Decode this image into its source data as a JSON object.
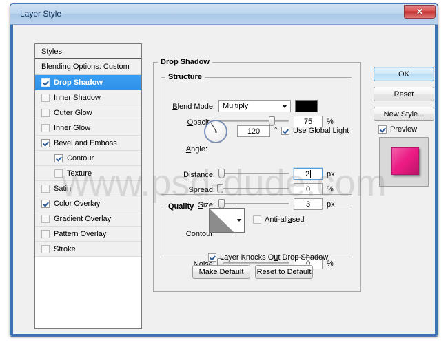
{
  "window": {
    "title": "Layer Style",
    "close_label": "✕"
  },
  "styles_panel": {
    "header": "Styles",
    "blending_options": "Blending Options: Custom",
    "items": [
      {
        "label": "Drop Shadow",
        "checked": true,
        "selected": true,
        "indent": false
      },
      {
        "label": "Inner Shadow",
        "checked": false,
        "selected": false,
        "indent": false
      },
      {
        "label": "Outer Glow",
        "checked": false,
        "selected": false,
        "indent": false
      },
      {
        "label": "Inner Glow",
        "checked": false,
        "selected": false,
        "indent": false
      },
      {
        "label": "Bevel and Emboss",
        "checked": true,
        "selected": false,
        "indent": false
      },
      {
        "label": "Contour",
        "checked": true,
        "selected": false,
        "indent": true
      },
      {
        "label": "Texture",
        "checked": false,
        "selected": false,
        "indent": true
      },
      {
        "label": "Satin",
        "checked": false,
        "selected": false,
        "indent": false
      },
      {
        "label": "Color Overlay",
        "checked": true,
        "selected": false,
        "indent": false
      },
      {
        "label": "Gradient Overlay",
        "checked": false,
        "selected": false,
        "indent": false
      },
      {
        "label": "Pattern Overlay",
        "checked": false,
        "selected": false,
        "indent": false
      },
      {
        "label": "Stroke",
        "checked": false,
        "selected": false,
        "indent": false
      }
    ]
  },
  "side_buttons": {
    "ok": "OK",
    "reset": "Reset",
    "new_style": "New Style...",
    "preview_label": "Preview",
    "preview_checked": true,
    "preview_color": "#ec1b84"
  },
  "drop_shadow": {
    "group_title": "Drop Shadow",
    "structure": {
      "title": "Structure",
      "blend_mode_label": "Blend Mode:",
      "blend_mode_value": "Multiply",
      "shadow_color": "#000000",
      "opacity_label": "Opacity:",
      "opacity_value": "75",
      "opacity_unit": "%",
      "opacity_percent": 75,
      "angle_label": "Angle:",
      "angle_value": "120",
      "angle_unit": "°",
      "use_global_light_label": "Use Global Light",
      "use_global_light_checked": true,
      "distance_label": "Distance:",
      "distance_value": "2",
      "distance_unit": "px",
      "distance_percent": 2,
      "spread_label": "Spread:",
      "spread_value": "0",
      "spread_unit": "%",
      "spread_percent": 0,
      "size_label": "Size:",
      "size_value": "3",
      "size_unit": "px",
      "size_percent": 2
    },
    "quality": {
      "title": "Quality",
      "contour_label": "Contour:",
      "anti_aliased_label": "Anti-aliased",
      "anti_aliased_checked": false,
      "noise_label": "Noise:",
      "noise_value": "0",
      "noise_unit": "%",
      "noise_percent": 0
    },
    "knockout_label": "Layer Knocks Out Drop Shadow",
    "knockout_checked": true,
    "make_default": "Make Default",
    "reset_to_default": "Reset to Default"
  },
  "watermark": {
    "text": "www.psd-dude.com"
  }
}
